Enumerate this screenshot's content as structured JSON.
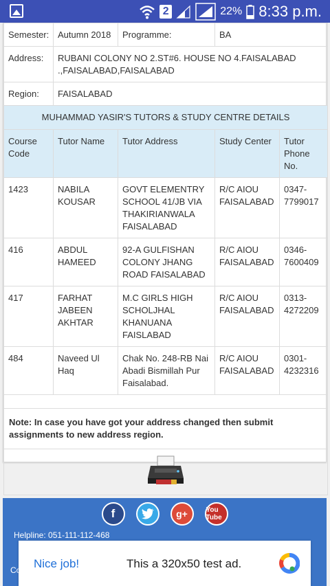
{
  "status_bar": {
    "sim_slot": "2",
    "battery": "22%",
    "time": "8:33 p.m."
  },
  "info_rows": [
    {
      "label": "Semester:",
      "value": "Autumn 2018",
      "label2": "Programme:",
      "value2": "BA"
    },
    {
      "label": "Address:",
      "value": "RUBANI COLONY NO 2.ST#6. HOUSE NO 4.FAISALABAD .,FAISALABAD,FAISALABAD"
    },
    {
      "label": "Region:",
      "value": "FAISALABAD"
    }
  ],
  "section_title": "MUHAMMAD YASIR'S TUTORS & STUDY CENTRE DETAILS",
  "columns": [
    "Course Code",
    "Tutor Name",
    "Tutor Address",
    "Study Center",
    "Tutor Phone No."
  ],
  "rows": [
    {
      "code": "1423",
      "name": "NABILA KOUSAR",
      "address": "GOVT ELEMENTRY SCHOOL 41/JB VIA THAKIRIANWALA FAISALABAD",
      "center": "R/C AIOU FAISALABAD",
      "phone": "0347-7799017"
    },
    {
      "code": "416",
      "name": "ABDUL HAMEED",
      "address": "92-A GULFISHAN COLONY JHANG ROAD FAISALABAD",
      "center": "R/C AIOU FAISALABAD",
      "phone": "0346-7600409"
    },
    {
      "code": "417",
      "name": "FARHAT JABEEN AKHTAR",
      "address": "M.C GIRLS HIGH SCHOLJHAL KHANUANA FAISLABAD",
      "center": "R/C AIOU FAISALABAD",
      "phone": "0313-4272209"
    },
    {
      "code": "484",
      "name": "Naveed Ul Haq",
      "address": "Chak No. 248-RB Nai Abadi Bismillah Pur Faisalabad.",
      "center": "R/C AIOU FAISALABAD",
      "phone": "0301-4232316"
    }
  ],
  "note": "Note: In case you have got your address changed then submit assignments to new address region.",
  "footer": {
    "social": [
      "f",
      "t",
      "g+",
      "You Tube"
    ],
    "helpline": "Helpline: 051-111-112-468",
    "copyright_fragment": "Co"
  },
  "ad": {
    "nice": "Nice job!",
    "text": "This a 320x50 test ad."
  },
  "colors": {
    "status_bar": "#3c50b5",
    "header_bg": "#d9ecf7",
    "footer_bg": "#3b74c6",
    "ad_link": "#1e6fd8"
  },
  "icons": [
    "photo-icon",
    "wifi-icon",
    "signal-icon",
    "battery-icon",
    "printer-icon",
    "facebook-icon",
    "twitter-icon",
    "google-plus-icon",
    "youtube-icon",
    "ad-logo-icon"
  ]
}
